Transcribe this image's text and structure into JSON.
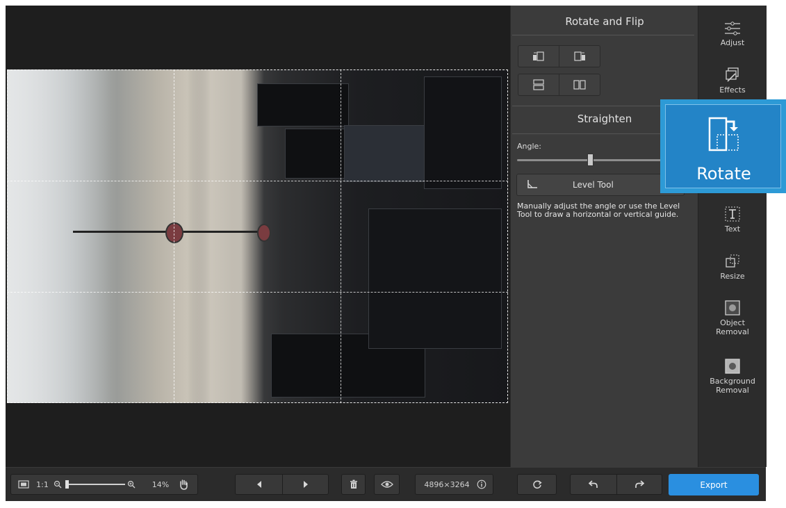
{
  "panel": {
    "rotate_flip_title": "Rotate and Flip",
    "straighten_title": "Straighten",
    "angle_label": "Angle:",
    "angle_value": 0.5,
    "level_tool_label": "Level Tool",
    "hint_text": "Manually adjust the angle or use the Level Tool to draw a horizontal or vertical guide."
  },
  "toolbar": {
    "adjust": "Adjust",
    "effects": "Effects",
    "text": "Text",
    "resize": "Resize",
    "object_removal_1": "Object",
    "object_removal_2": "Removal",
    "background_removal_1": "Background",
    "background_removal_2": "Removal"
  },
  "highlight": {
    "rotate_label": "Rotate",
    "color": "#2d9ad6"
  },
  "bottom": {
    "zoom_1to1": "1:1",
    "zoom_percent": "14%",
    "dimensions": "4896×3264",
    "export_label": "Export"
  },
  "colors": {
    "accent": "#2a8fe0",
    "panel_bg": "#3b3b3b",
    "canvas_bg": "#1e1e1e"
  }
}
